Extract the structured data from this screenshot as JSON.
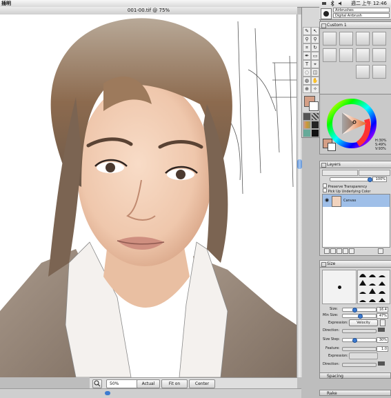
{
  "menubar": {
    "app_name": "插明",
    "day": "週二",
    "time": "上午 12:46"
  },
  "document": {
    "title": "001-00.tif @ 75%"
  },
  "bottombar": {
    "zoom_value": "50%",
    "buttons": [
      "Actual Pixels",
      "Fit on Screen",
      "Center Image"
    ]
  },
  "brush_selector": {
    "category": "Airbrushes",
    "variant": "Digital Airbrush"
  },
  "custom_palette": {
    "title": "Custom 1"
  },
  "color_panel": {
    "hsv": [
      "H:30%",
      "S:49%",
      "V:93%"
    ]
  },
  "layers_panel": {
    "title": "Layers",
    "opacity": "100%",
    "options": [
      "Preserve Transparency",
      "Pick Up Underlying Color"
    ],
    "layer_name": "Canvas"
  },
  "size_panel": {
    "title": "Size",
    "rows": [
      {
        "label": "Size:",
        "value": "16.4"
      },
      {
        "label": "Min Size:",
        "value": "47%"
      }
    ],
    "expression_label": "Expression:",
    "expression_value": "Velocity",
    "direction_label": "Direction:",
    "size_step_label": "Size Step:",
    "size_step_value": "30%",
    "feature_label": "Feature:",
    "feature_value": "1.0",
    "expression2_label": "Expression:",
    "direction2_label": "Direction:"
  },
  "collapsed_panels": [
    "Spacing",
    "Rake"
  ],
  "colors": {
    "accent": "#3d7bd0",
    "main_color": "#d49f86",
    "skin": "#f3d2bd",
    "hair": "#8a6a52",
    "jacket": "#9c8a78"
  }
}
